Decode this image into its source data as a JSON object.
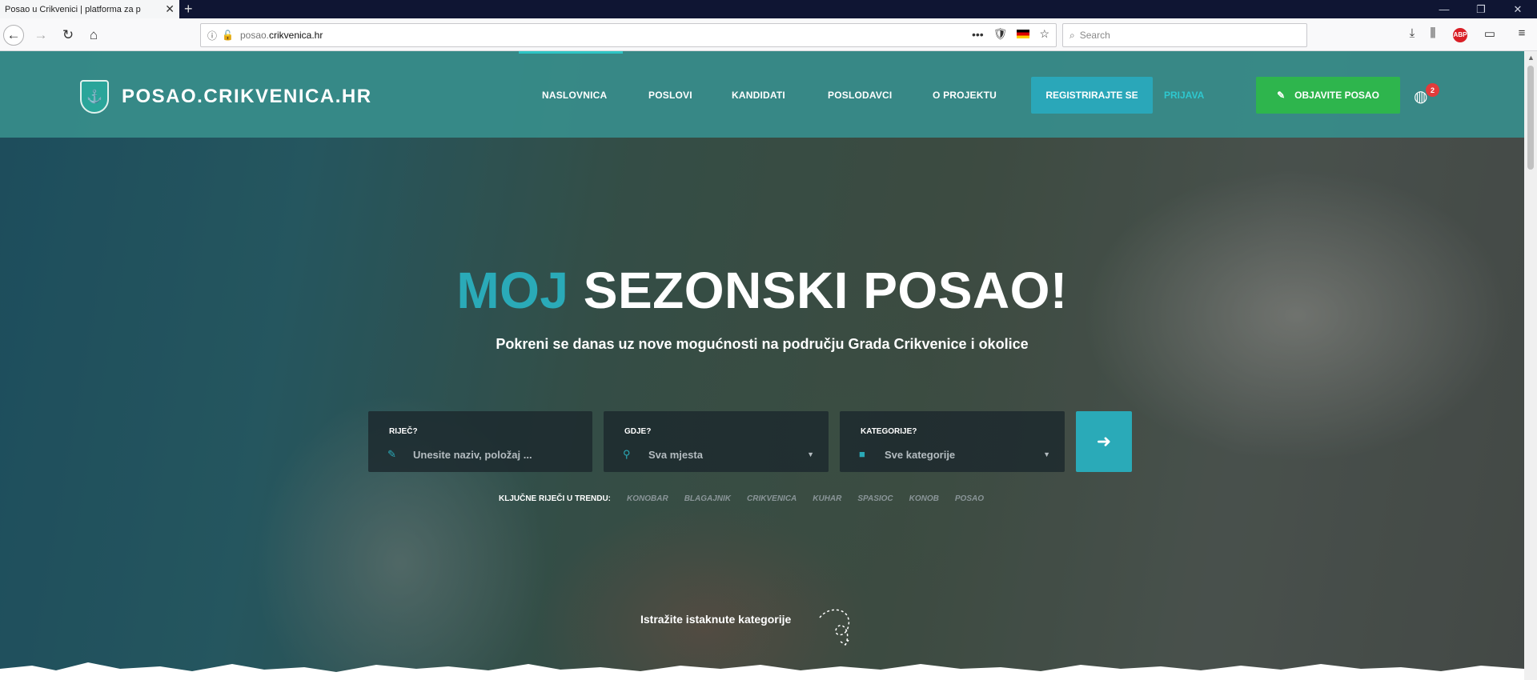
{
  "browser": {
    "tab_title": "Posao u Crikvenici | platforma za p",
    "tab_close": "✕",
    "new_tab": "+",
    "url_prefix": "posao.",
    "url_host": "crikvenica.hr",
    "search_placeholder": "Search"
  },
  "site": {
    "logo_text": "POSAO.CRIKVENICA.HR",
    "nav": [
      "NASLOVNICA",
      "POSLOVI",
      "KANDIDATI",
      "POSLODAVCI",
      "O PROJEKTU"
    ],
    "register_label": "REGISTRIRAJTE SE",
    "login_label": "PRIJAVA",
    "post_job_label": "OBJAVITE POSAO",
    "notification_count": "2"
  },
  "hero": {
    "title_accent": "MOJ",
    "title_rest": "SEZONSKI POSAO!",
    "subtitle": "Pokreni se danas uz nove mogućnosti na području Grada Crikvenice i okolice"
  },
  "search": {
    "what_label": "RIJEČ?",
    "what_placeholder": "Unesite naziv, položaj ...",
    "where_label": "GDJE?",
    "where_value": "Sva mjesta",
    "category_label": "KATEGORIJE?",
    "category_value": "Sve kategorije"
  },
  "trending": {
    "label": "KLJUČNE RIJEČI U TRENDU:",
    "words": [
      "KONOBAR",
      "BLAGAJNIK",
      "CRIKVENICA",
      "KUHAR",
      "SPASIOC",
      "KONOB",
      "POSAO"
    ]
  },
  "explore_label": "Istražite istaknute kategorije",
  "colors": {
    "teal_header": "#378c8a",
    "accent": "#2aaab8",
    "green": "#2eb54d"
  }
}
